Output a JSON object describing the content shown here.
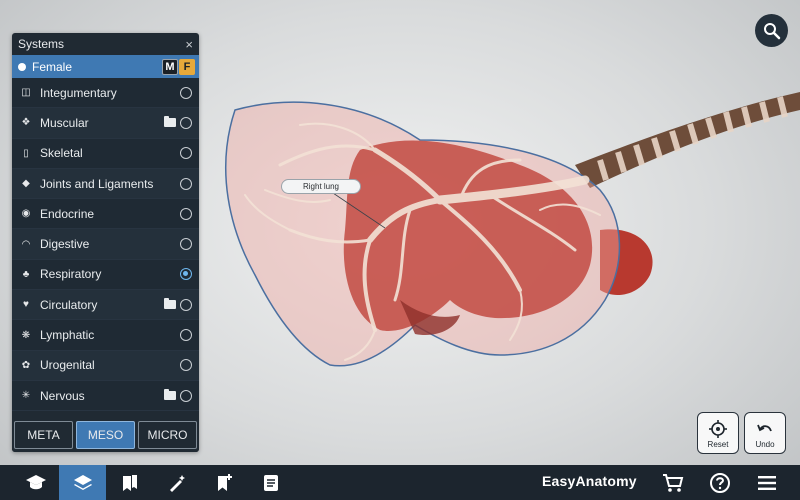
{
  "panel": {
    "title": "Systems",
    "close": "×",
    "sex": {
      "label": "Female",
      "male_badge": "M",
      "female_badge": "F"
    },
    "systems": [
      {
        "label": "Integumentary",
        "icon": "skin-icon",
        "folder": false,
        "selected": false
      },
      {
        "label": "Muscular",
        "icon": "muscle-icon",
        "folder": true,
        "selected": false
      },
      {
        "label": "Skeletal",
        "icon": "bone-icon",
        "folder": false,
        "selected": false
      },
      {
        "label": "Joints and Ligaments",
        "icon": "joint-icon",
        "folder": false,
        "selected": false
      },
      {
        "label": "Endocrine",
        "icon": "gland-icon",
        "folder": false,
        "selected": false
      },
      {
        "label": "Digestive",
        "icon": "stomach-icon",
        "folder": false,
        "selected": false
      },
      {
        "label": "Respiratory",
        "icon": "lungs-icon",
        "folder": false,
        "selected": true
      },
      {
        "label": "Circulatory",
        "icon": "heart-icon",
        "folder": true,
        "selected": false
      },
      {
        "label": "Lymphatic",
        "icon": "lymph-icon",
        "folder": false,
        "selected": false
      },
      {
        "label": "Urogenital",
        "icon": "kidney-icon",
        "folder": false,
        "selected": false
      },
      {
        "label": "Nervous",
        "icon": "neuron-icon",
        "folder": true,
        "selected": false
      }
    ],
    "levels": [
      "META",
      "MESO",
      "MICRO"
    ],
    "active_level": "MESO"
  },
  "viewport": {
    "tag": "Right lung"
  },
  "controls": {
    "reset": "Reset",
    "undo": "Undo"
  },
  "toolbar": {
    "brand": "EasyAnatomy"
  },
  "colors": {
    "accent": "#3f79b3",
    "panel": "#202a33",
    "toolbar": "#1c252e",
    "badge_f": "#e7a93a"
  }
}
